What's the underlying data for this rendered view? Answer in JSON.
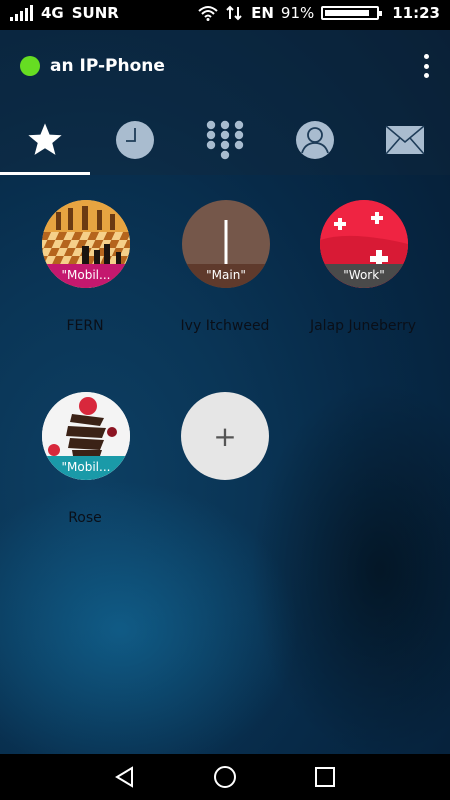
{
  "statusbar": {
    "network": "4G",
    "carrier": "SUNR",
    "language": "EN",
    "battery": "91%",
    "time": "11:23"
  },
  "header": {
    "title": "an IP-Phone",
    "presence_color": "#66dd22"
  },
  "tabs": [
    {
      "icon": "star-icon",
      "selected": true
    },
    {
      "icon": "clock-icon"
    },
    {
      "icon": "dialpad-icon"
    },
    {
      "icon": "contacts-icon"
    },
    {
      "icon": "mail-icon"
    }
  ],
  "favorites": [
    {
      "name": "FERN",
      "tag": "\"Mobil...",
      "tag_color": "#c4186e",
      "image": "chess"
    },
    {
      "name": "Ivy Itchweed",
      "tag": "\"Main\"",
      "tag_color": "#5f3a2c",
      "image": "initial"
    },
    {
      "name": "Jalap Juneberry",
      "tag": "\"Work\"",
      "tag_color": "#4a4a4a",
      "image": "swiss-flag"
    },
    {
      "name": "Rose",
      "tag": "\"Mobil...",
      "tag_color": "#1a9aa8",
      "image": "chocolate"
    }
  ],
  "add_button": {
    "label": "+"
  },
  "navbar": [
    "back-icon",
    "home-icon",
    "recents-icon"
  ]
}
